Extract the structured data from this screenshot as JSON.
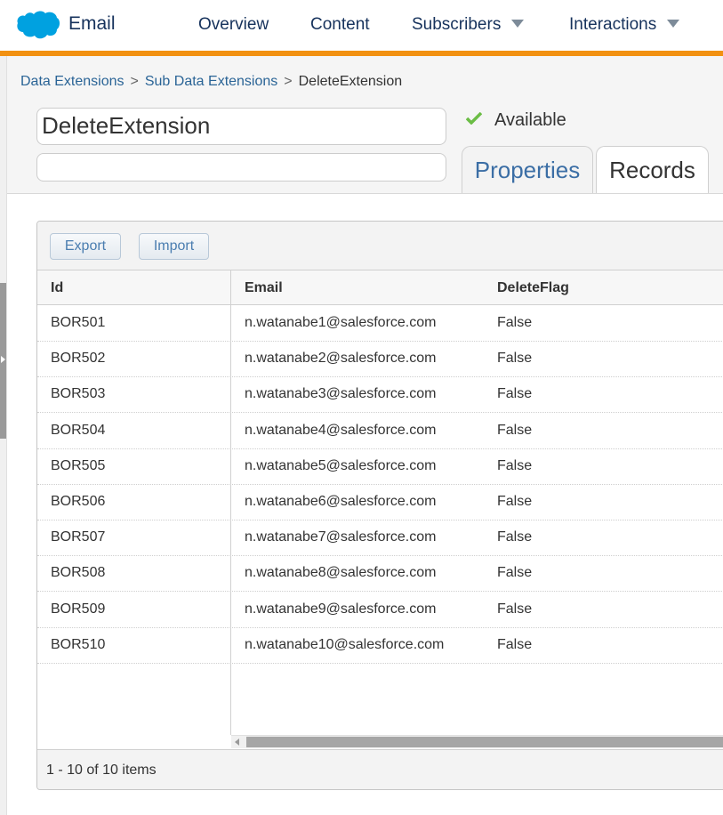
{
  "nav": {
    "brand": "Email",
    "items": [
      {
        "label": "Overview"
      },
      {
        "label": "Content"
      },
      {
        "label": "Subscribers"
      },
      {
        "label": "Interactions"
      }
    ]
  },
  "breadcrumb": {
    "items": [
      "Data Extensions",
      "Sub Data Extensions"
    ],
    "separator": ">",
    "current": "DeleteExtension"
  },
  "extension": {
    "name": "DeleteExtension",
    "description": "",
    "status": "Available"
  },
  "tabs": [
    {
      "label": "Properties",
      "active": false
    },
    {
      "label": "Records",
      "active": true
    }
  ],
  "toolbar": {
    "export_label": "Export",
    "import_label": "Import"
  },
  "table": {
    "columns": [
      "Id",
      "Email",
      "DeleteFlag"
    ],
    "rows": [
      {
        "id": "BOR501",
        "email": "n.watanabe1@salesforce.com",
        "flag": "False"
      },
      {
        "id": "BOR502",
        "email": "n.watanabe2@salesforce.com",
        "flag": "False"
      },
      {
        "id": "BOR503",
        "email": "n.watanabe3@salesforce.com",
        "flag": "False"
      },
      {
        "id": "BOR504",
        "email": "n.watanabe4@salesforce.com",
        "flag": "False"
      },
      {
        "id": "BOR505",
        "email": "n.watanabe5@salesforce.com",
        "flag": "False"
      },
      {
        "id": "BOR506",
        "email": "n.watanabe6@salesforce.com",
        "flag": "False"
      },
      {
        "id": "BOR507",
        "email": "n.watanabe7@salesforce.com",
        "flag": "False"
      },
      {
        "id": "BOR508",
        "email": "n.watanabe8@salesforce.com",
        "flag": "False"
      },
      {
        "id": "BOR509",
        "email": "n.watanabe9@salesforce.com",
        "flag": "False"
      },
      {
        "id": "BOR510",
        "email": "n.watanabe10@salesforce.com",
        "flag": "False"
      }
    ]
  },
  "pager": {
    "summary": "1 - 10 of 10 items"
  },
  "colors": {
    "accent_bar": "#f29111",
    "brand_blue": "#00a1e0",
    "link": "#2a6496",
    "status_check": "#6bbd45"
  },
  "icons": {
    "logo": "salesforce-cloud-icon",
    "dropdown": "chevron-down-icon",
    "status": "check-icon"
  }
}
